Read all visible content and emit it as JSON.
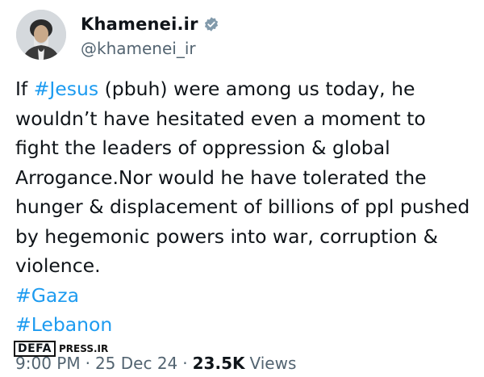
{
  "author": {
    "display_name": "Khamenei.ir",
    "handle": "@khamenei_ir",
    "verified_icon": "verified-badge-icon"
  },
  "tweet": {
    "part1": "If ",
    "hashtag1": "#Jesus",
    "part2": " (pbuh) were among us today, he wouldn’t have hesitated even a moment to fight the leaders of oppression & global Arrogance.Nor would he have tolerated the hunger & displacement of billions of ppl pushed by hegemonic powers into war, corruption & violence.",
    "hashtag2": "#Gaza",
    "hashtag3": "#Lebanon"
  },
  "meta": {
    "time": "9:00 PM",
    "separator": "·",
    "date": "25 Dec 24",
    "views_count": "23.5K",
    "views_label": "Views"
  },
  "watermark": {
    "logo_text": "DEFA",
    "suffix": "PRESS.IR"
  },
  "colors": {
    "hashtag": "#1d9bf0",
    "text": "#0f1419",
    "muted": "#536471"
  }
}
